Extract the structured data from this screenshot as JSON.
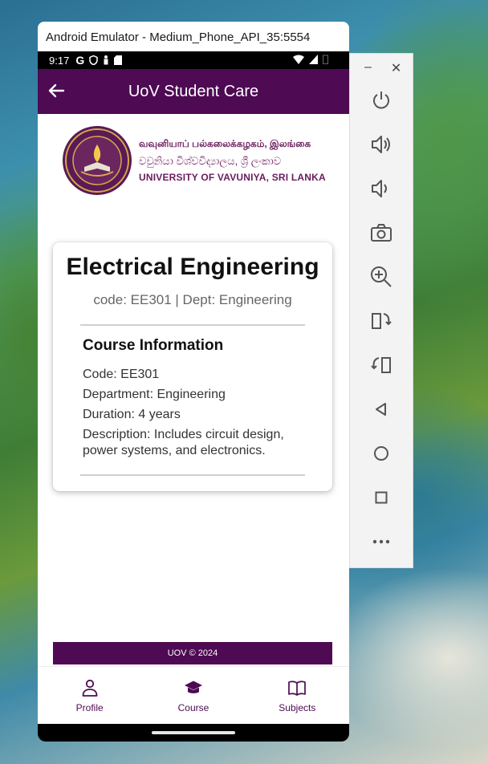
{
  "window": {
    "title": "Android Emulator - Medium_Phone_API_35:5554"
  },
  "status_bar": {
    "time": "9:17",
    "google_glyph": "G"
  },
  "app_bar": {
    "title": "UoV Student Care"
  },
  "university": {
    "name_tamil": "வவுனியாப் பல்கலைக்கழகம், இலங்கை",
    "name_sinhala": "වවුනියා විශ්වවිද්‍යාලය, ශ්‍රී ලංකාව",
    "name_english": "UNIVERSITY OF VAVUNIYA, SRI LANKA"
  },
  "course": {
    "title": "Electrical Engineering",
    "subtitle": "code: EE301  | Dept:  Engineering",
    "info_heading": "Course Information",
    "code_line": "Code: EE301",
    "department_line": "Department: Engineering",
    "duration_line": "Duration: 4 years",
    "description_line": "Description: Includes circuit design, power systems, and electronics."
  },
  "footer": {
    "text": "UOV © 2024"
  },
  "bottom_nav": {
    "items": [
      {
        "label": "Profile",
        "icon": "person-icon"
      },
      {
        "label": "Course",
        "icon": "graduation-cap-icon"
      },
      {
        "label": "Subjects",
        "icon": "book-icon"
      }
    ]
  },
  "side_toolbar": {
    "icons": [
      "power-icon",
      "volume-up-icon",
      "volume-down-icon",
      "camera-icon",
      "zoom-in-icon",
      "rotate-left-icon",
      "rotate-right-icon",
      "back-icon",
      "home-icon",
      "overview-icon",
      "more-icon"
    ]
  },
  "colors": {
    "brand": "#4e0a53",
    "accent_text": "#6a1b5c"
  }
}
